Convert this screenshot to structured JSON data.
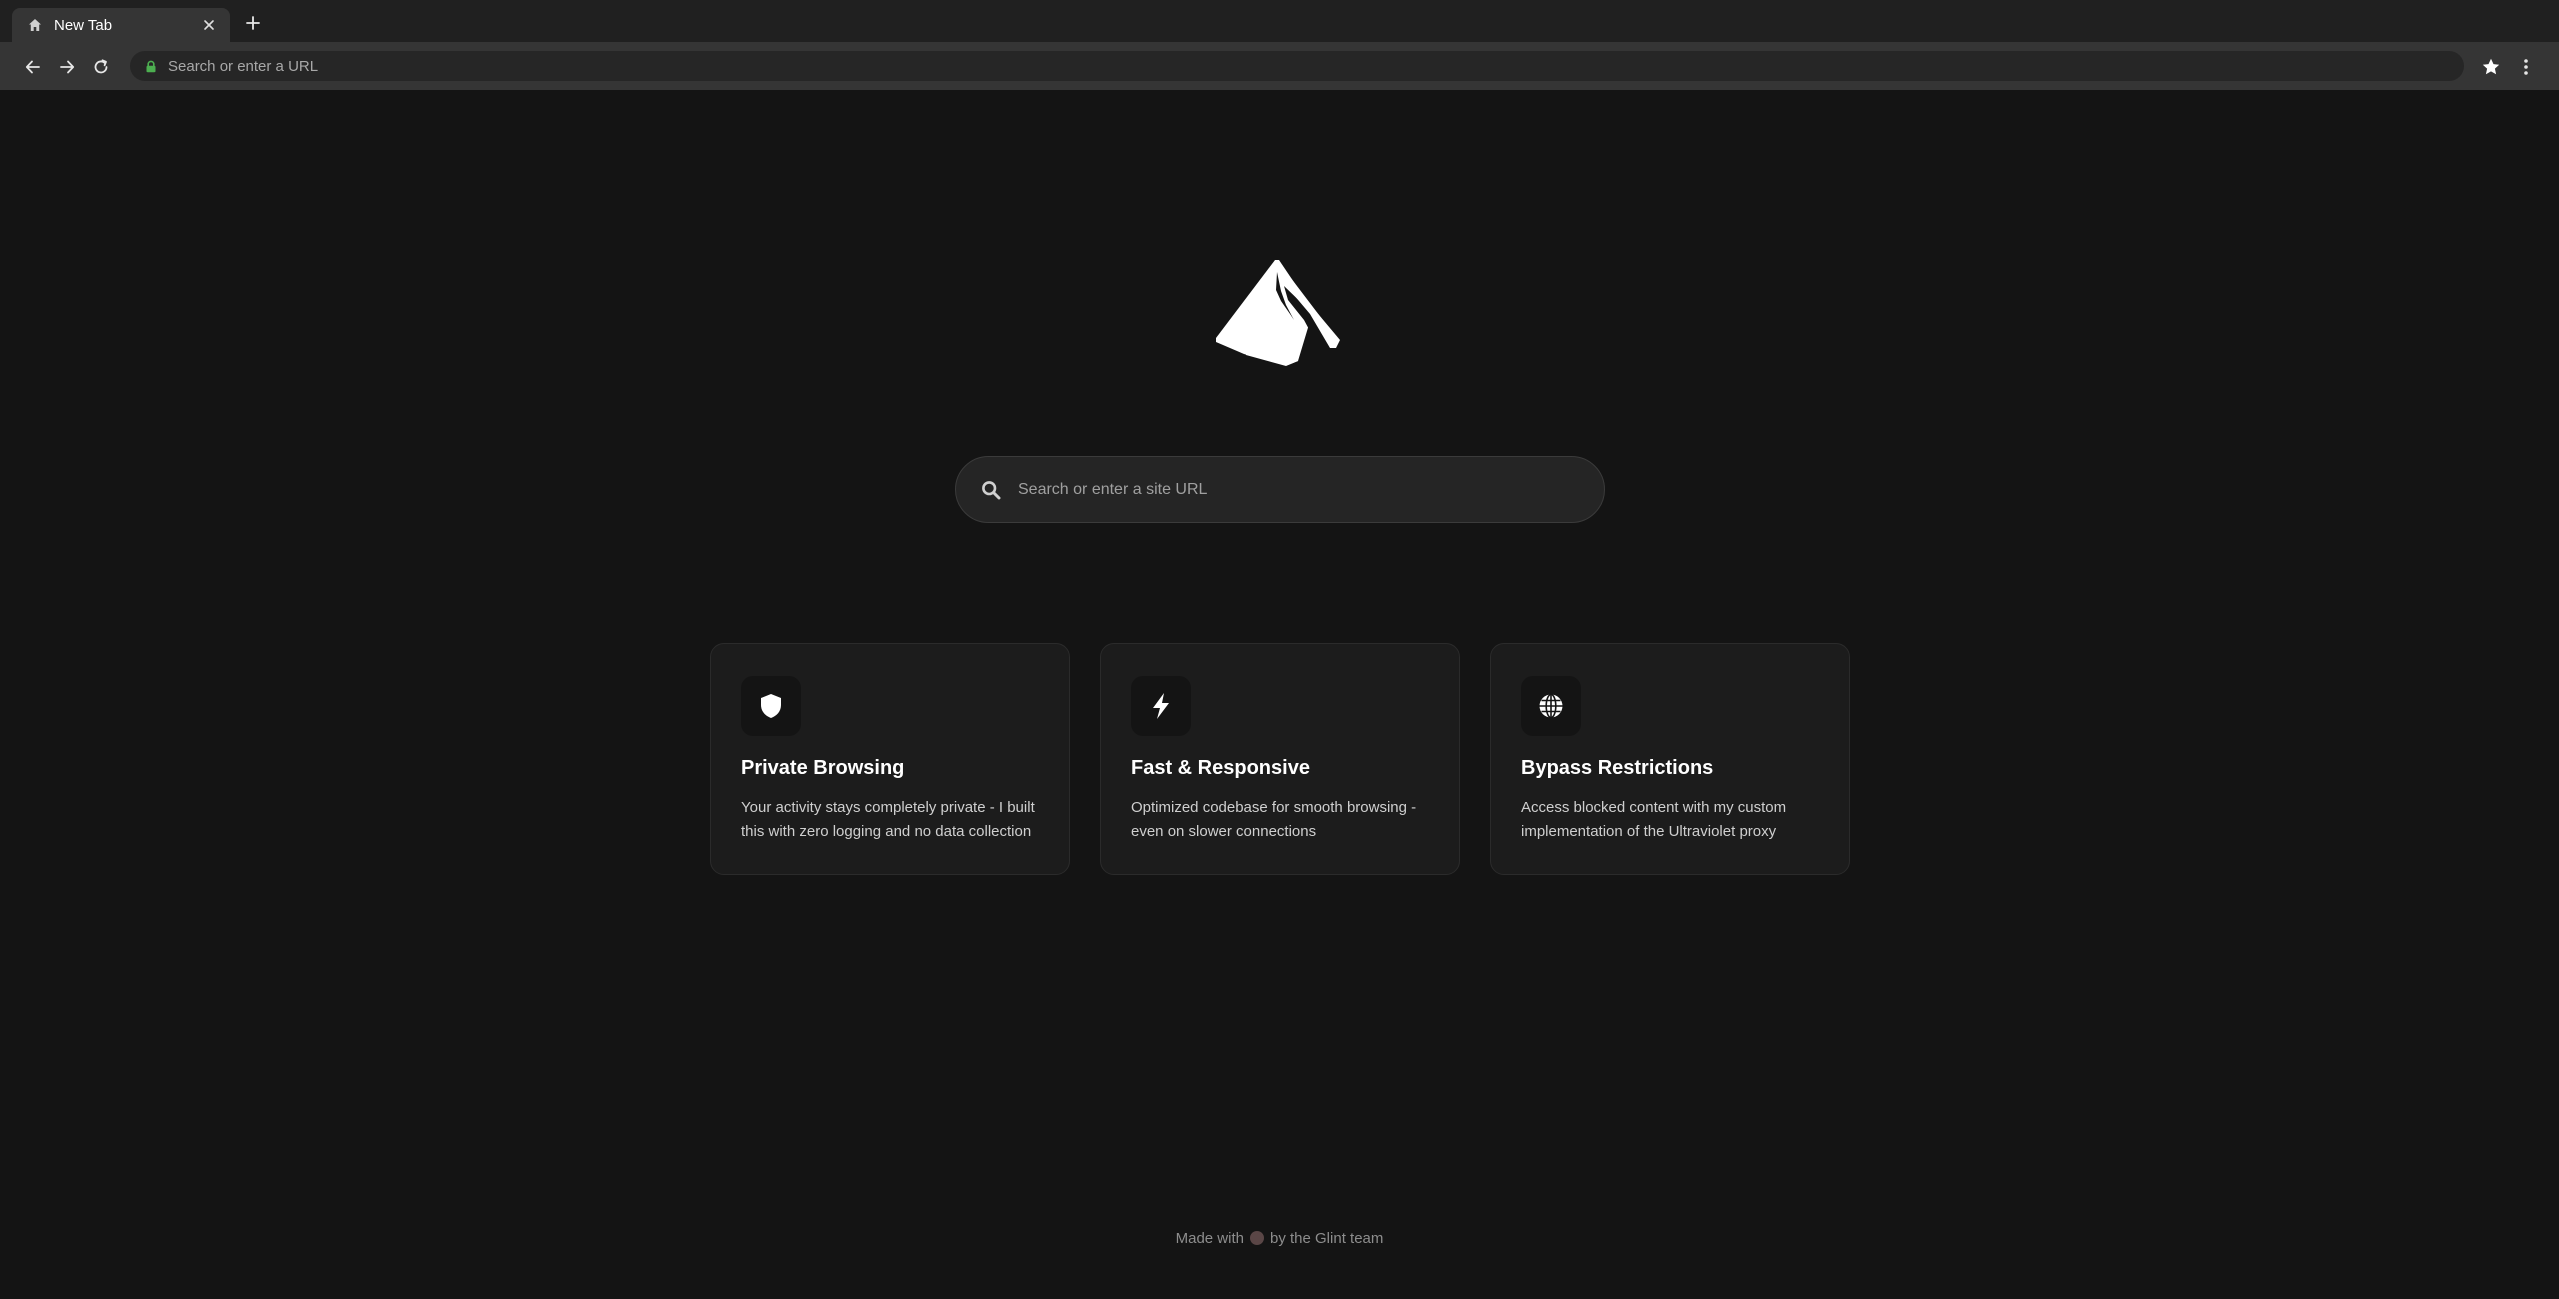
{
  "browser": {
    "tab": {
      "title": "New Tab",
      "icon": "home-icon"
    },
    "new_tab_icon": "plus-icon",
    "toolbar": {
      "back_icon": "arrow-left-icon",
      "forward_icon": "arrow-right-icon",
      "reload_icon": "reload-icon",
      "lock_color": "#4caf50",
      "address_placeholder": "Search or enter a URL",
      "bookmark_icon": "star-icon",
      "menu_icon": "kebab-menu-icon"
    }
  },
  "page": {
    "logo": "mountain-logo",
    "search": {
      "placeholder": "Search or enter a site URL",
      "icon": "search-icon"
    },
    "features": [
      {
        "icon": "shield-icon",
        "title": "Private Browsing",
        "text": "Your activity stays completely private - I built this with zero logging and no data collection"
      },
      {
        "icon": "lightning-bolt-icon",
        "title": "Fast & Responsive",
        "text": "Optimized codebase for smooth browsing - even on slower connections"
      },
      {
        "icon": "globe-icon",
        "title": "Bypass Restrictions",
        "text": "Access blocked content with my custom implementation of the Ultraviolet proxy"
      }
    ],
    "footer": {
      "prefix": "Made with",
      "suffix": "by the Glint team"
    }
  },
  "colors": {
    "background": "#141414",
    "card": "#1c1c1c",
    "search_box": "#252525",
    "chrome_tabstrip": "#202020",
    "chrome_toolbar": "#353535"
  }
}
